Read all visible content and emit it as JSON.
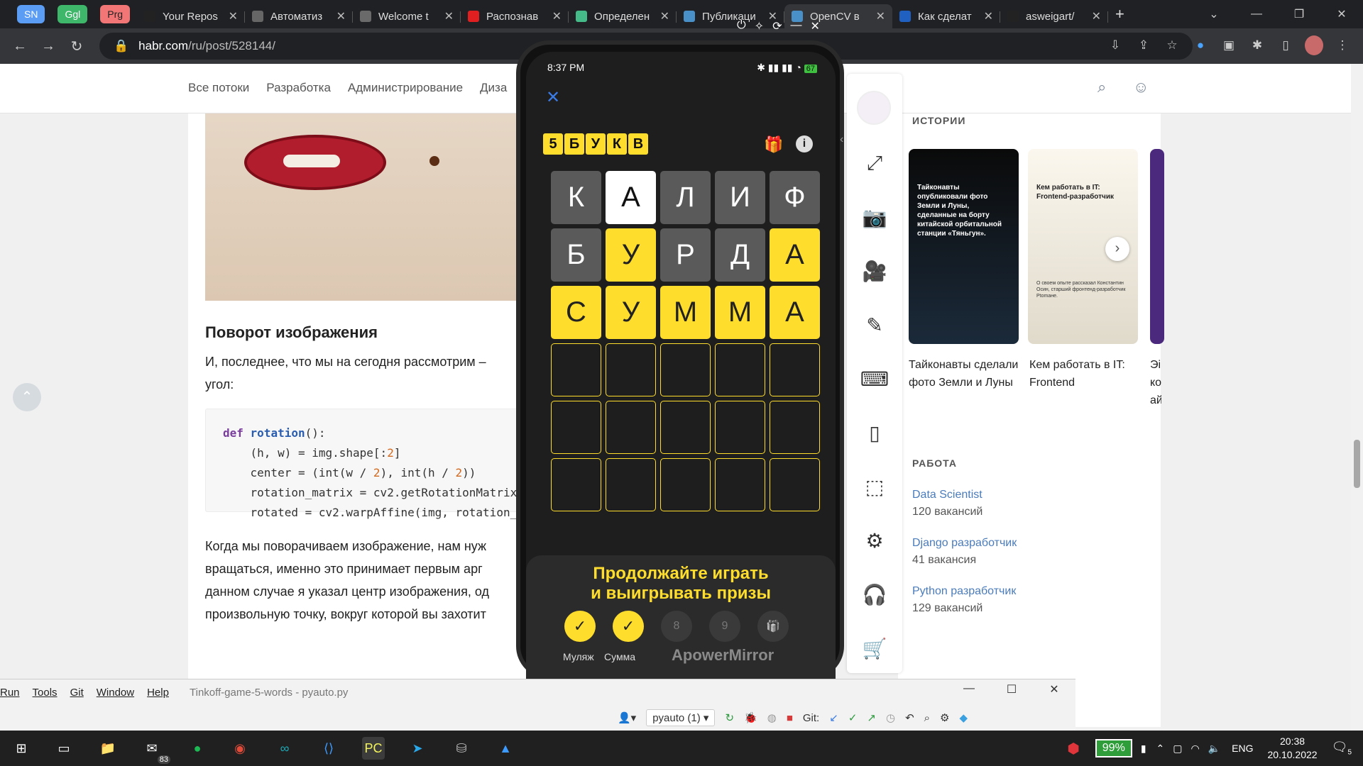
{
  "browser": {
    "quick_tabs": [
      "SN",
      "Ggl",
      "Prg"
    ],
    "tabs": [
      {
        "title": "Your Repos",
        "icon": "github-icon"
      },
      {
        "title": "Автоматиз",
        "icon": "openai-icon"
      },
      {
        "title": "Welcome t",
        "icon": "docs-icon"
      },
      {
        "title": "Распознав",
        "icon": "youtube-icon"
      },
      {
        "title": "Определен",
        "icon": "extension-icon"
      },
      {
        "title": "Публикаци",
        "icon": "habr-icon"
      },
      {
        "title": "OpenCV в",
        "icon": "habr-icon"
      },
      {
        "title": "Как сделат",
        "icon": "blue-icon"
      },
      {
        "title": "asweigart/",
        "icon": "github-icon"
      }
    ],
    "url_domain": "habr.com",
    "url_path": "/ru/post/528144/"
  },
  "habr": {
    "nav": [
      "Все потоки",
      "Разработка",
      "Администрирование",
      "Диза"
    ],
    "heading": "Поворот изображения",
    "para1_l1": "И, последнее, что мы на сегодня рассмотрим –",
    "para1_l2": "угол:",
    "code": [
      "def rotation():",
      "    (h, w) = img.shape[:2]",
      "    center = (int(w / 2), int(h / 2))",
      "    rotation_matrix = cv2.getRotationMatrix",
      "    rotated = cv2.warpAffine(img, rotation_"
    ],
    "para2": [
      "Когда мы поворачиваем изображение, нам нуж",
      "вращаться, именно это принимает первым арг",
      "данном случае я указал центр изображения, од",
      "произвольную точку, вокруг которой вы захотит"
    ],
    "stories_title": "ИСТОРИИ",
    "stories": [
      {
        "card": "Тайконавты опубликовали фото Земли и Луны, сделанные на борту китайской орбитальной станции «Тяньгун».",
        "caption": "Тайконавты сделали фото Земли и Луны"
      },
      {
        "card": "Кем работать в IT: Frontend-разработчик",
        "card_small": "О своем опыте рассказал Константин Осин, старший фронтенд-разработчик Ptomaне.",
        "caption": "Кем работать в IT: Frontend"
      },
      {
        "card": "",
        "caption": "Эі\nко\nай"
      }
    ],
    "jobs_title": "РАБОТА",
    "jobs": [
      {
        "title": "Data Scientist",
        "count": "120 вакансий"
      },
      {
        "title": "Django разработчик",
        "count": "41 вакансия"
      },
      {
        "title": "Python разработчик",
        "count": "129 вакансий"
      }
    ]
  },
  "phone": {
    "time": "8:37 PM",
    "battery": "67",
    "logo_letters": [
      "5",
      "Б",
      "У",
      "К",
      "В"
    ],
    "rows": [
      [
        {
          "l": "К",
          "s": "g"
        },
        {
          "l": "А",
          "s": "w"
        },
        {
          "l": "Л",
          "s": "g"
        },
        {
          "l": "И",
          "s": "g"
        },
        {
          "l": "Ф",
          "s": "g"
        }
      ],
      [
        {
          "l": "Б",
          "s": "g"
        },
        {
          "l": "У",
          "s": "y"
        },
        {
          "l": "Р",
          "s": "g"
        },
        {
          "l": "Д",
          "s": "g"
        },
        {
          "l": "А",
          "s": "y"
        }
      ],
      [
        {
          "l": "С",
          "s": "y"
        },
        {
          "l": "У",
          "s": "y"
        },
        {
          "l": "М",
          "s": "y"
        },
        {
          "l": "М",
          "s": "y"
        },
        {
          "l": "А",
          "s": "y"
        }
      ],
      [
        {
          "l": "",
          "s": "e"
        },
        {
          "l": "",
          "s": "e"
        },
        {
          "l": "",
          "s": "e"
        },
        {
          "l": "",
          "s": "e"
        },
        {
          "l": "",
          "s": "e"
        }
      ],
      [
        {
          "l": "",
          "s": "e"
        },
        {
          "l": "",
          "s": "e"
        },
        {
          "l": "",
          "s": "e"
        },
        {
          "l": "",
          "s": "e"
        },
        {
          "l": "",
          "s": "e"
        }
      ],
      [
        {
          "l": "",
          "s": "e"
        },
        {
          "l": "",
          "s": "e"
        },
        {
          "l": "",
          "s": "e"
        },
        {
          "l": "",
          "s": "e"
        },
        {
          "l": "",
          "s": "e"
        }
      ]
    ],
    "promo_l1": "Продолжайте играть",
    "promo_l2": "и выигрывать призы",
    "steps": [
      {
        "v": "✓",
        "done": true,
        "label": "Муляж"
      },
      {
        "v": "✓",
        "done": true,
        "label": "Сумма"
      },
      {
        "v": "8",
        "done": false,
        "label": ""
      },
      {
        "v": "9",
        "done": false,
        "label": ""
      },
      {
        "v": "gift",
        "done": false,
        "label": ""
      }
    ],
    "watermark": "ApowerMirror"
  },
  "pycharm": {
    "menu": [
      "Run",
      "Tools",
      "Git",
      "Window",
      "Help"
    ],
    "title": "Tinkoff-game-5-words - pyauto.py",
    "run_config": "pyauto (1)",
    "git_label": "Git:"
  },
  "taskbar": {
    "mail_badge": "83",
    "battery": "99%",
    "lang": "ENG",
    "time": "20:38",
    "date": "20.10.2022",
    "notif": "5"
  }
}
